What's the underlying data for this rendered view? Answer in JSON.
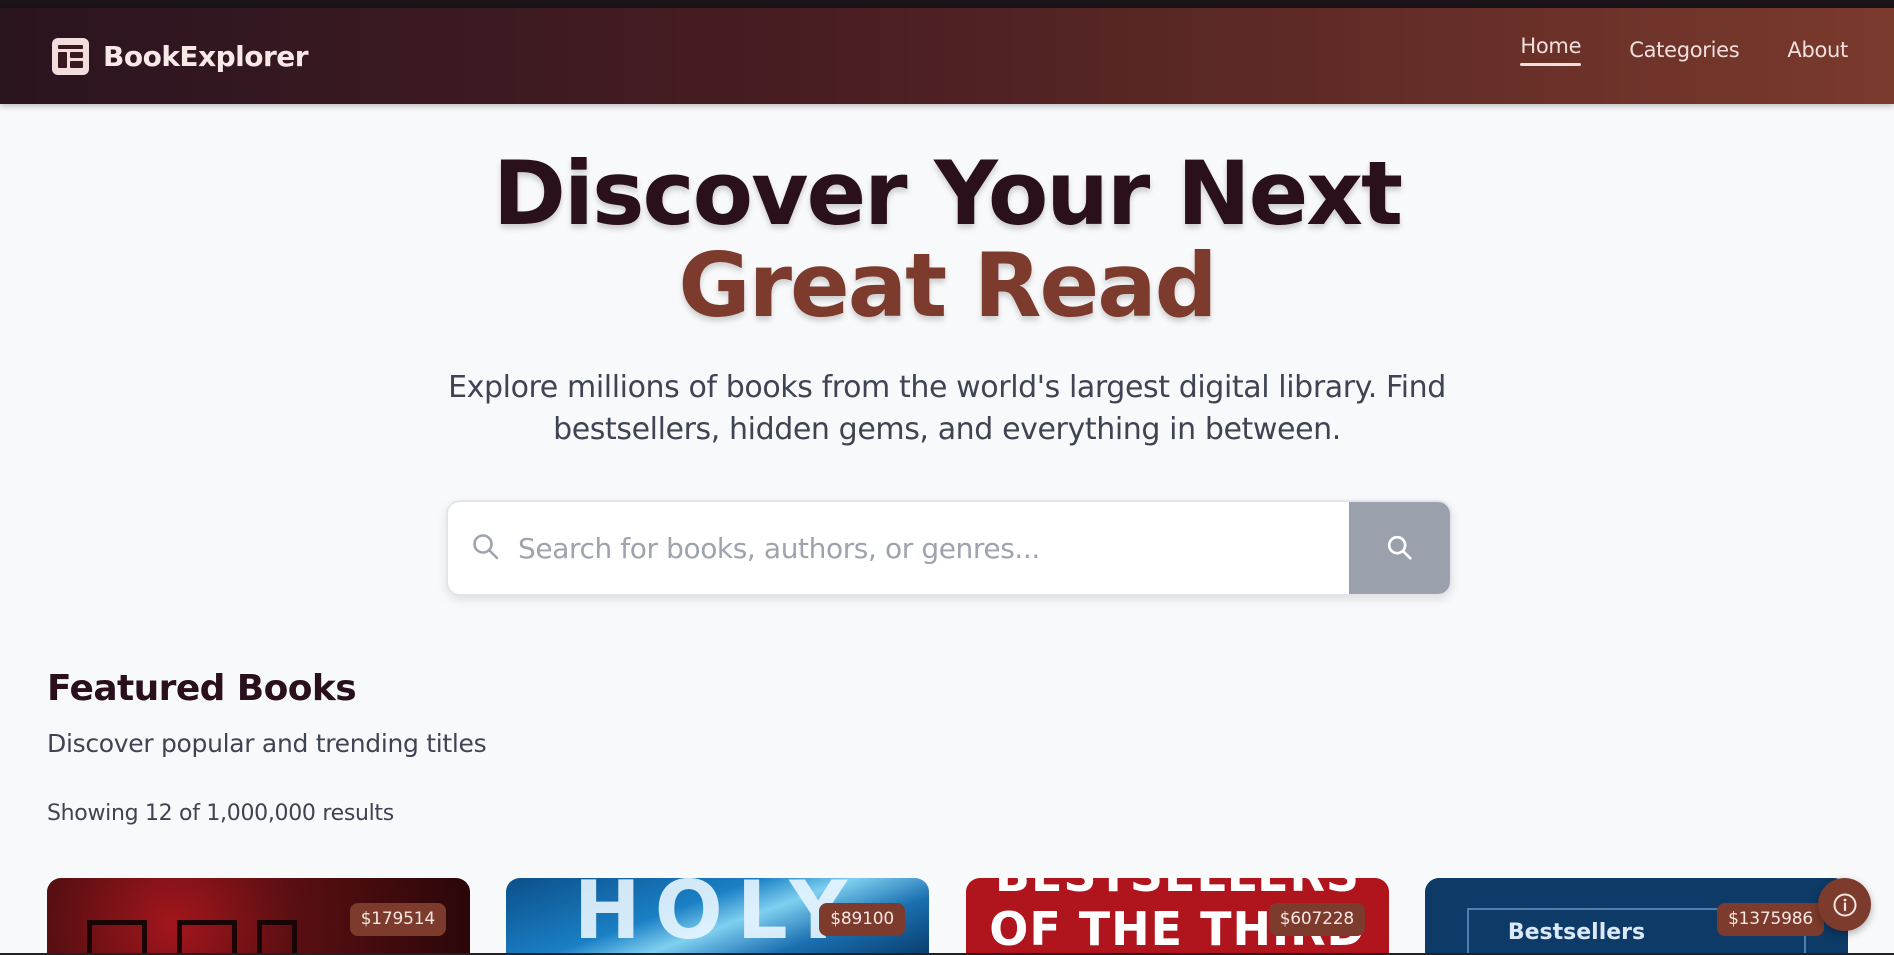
{
  "app": {
    "brand_name": "BookExplorer",
    "brand_icon": "newspaper-layout-icon"
  },
  "nav": {
    "links": [
      {
        "label": "Home",
        "active": true
      },
      {
        "label": "Categories",
        "active": false
      },
      {
        "label": "About",
        "active": false
      }
    ]
  },
  "hero": {
    "title_main": "Discover Your Next ",
    "title_accent": "Great Read",
    "subtitle": "Explore millions of books from the world's largest digital library. Find bestsellers, hidden gems, and everything in between."
  },
  "search": {
    "placeholder": "Search for books, authors, or genres...",
    "value": "",
    "left_icon": "search-icon",
    "button_icon": "search-icon"
  },
  "featured": {
    "title": "Featured Books",
    "subtitle": "Discover popular and trending titles",
    "results_text": "Showing 12 of 1,000,000 results",
    "books": [
      {
        "price": "$179514",
        "cover_text": "",
        "cover_color": "#5a0f12"
      },
      {
        "price": "$89100",
        "cover_text": "HOLY",
        "cover_color": "#1a6fb0"
      },
      {
        "price": "$607228",
        "cover_text": "BESTSELLERS OF THE THIRD",
        "cover_color": "#b0151d"
      },
      {
        "price": "$1375986",
        "cover_text": "Bestsellers",
        "cover_color": "#0d3a66"
      }
    ]
  },
  "colors": {
    "accent": "#7c3b2c",
    "heading": "#2a0f1c",
    "nav_start": "#2a1420",
    "nav_end": "#7a3a2c"
  },
  "fab": {
    "icon": "info-icon"
  }
}
